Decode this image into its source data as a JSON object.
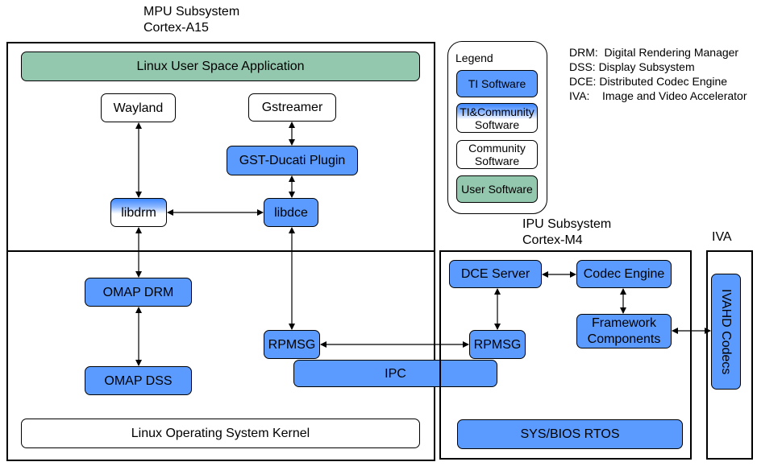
{
  "mpu": {
    "title_line1": "MPU Subsystem",
    "title_line2": "Cortex-A15"
  },
  "ipu": {
    "title_line1": "IPU Subsystem",
    "title_line2": "Cortex-M4"
  },
  "iva": {
    "title": "IVA"
  },
  "blocks": {
    "user_app": "Linux User Space Application",
    "wayland": "Wayland",
    "gstreamer": "Gstreamer",
    "gst_ducati": "GST-Ducati Plugin",
    "libdrm": "libdrm",
    "libdce": "libdce",
    "omap_drm": "OMAP DRM",
    "omap_dss": "OMAP DSS",
    "rpmsg_mpu": "RPMSG",
    "ipc": "IPC",
    "kernel": "Linux Operating System Kernel",
    "dce_server": "DCE Server",
    "codec_engine": "Codec Engine",
    "framework": "Framework\nComponents",
    "rpmsg_ipu": "RPMSG",
    "sysbios": "SYS/BIOS RTOS",
    "ivahd": "IVAHD Codecs"
  },
  "legend": {
    "title": "Legend",
    "items": [
      "TI Software",
      "TI&Community\nSoftware",
      "Community\nSoftware",
      "User Software"
    ]
  },
  "glossary": [
    "DRM:  Digital Rendering Manager",
    "DSS: Display Subsystem",
    "DCE: Distributed Codec Engine",
    "IVA:    Image and Video Accelerator"
  ],
  "colors": {
    "ti": "#5b9bff",
    "community": "#ffffff",
    "user": "#93c8ae"
  }
}
